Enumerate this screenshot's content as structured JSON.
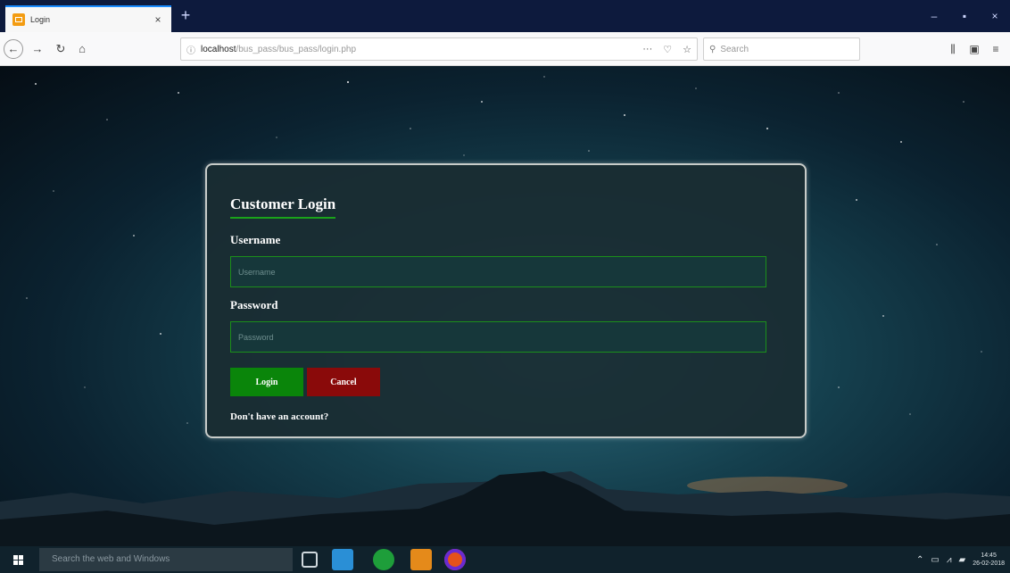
{
  "browser": {
    "tab_title": "Login",
    "tab_close": "×",
    "new_tab": "+",
    "window_controls": {
      "minimize": "–",
      "maximize": "▪",
      "close": "×"
    },
    "url_host": "localhost",
    "url_path": "/bus_pass/bus_pass/login.php",
    "search_placeholder": "Search",
    "page_actions": [
      "···",
      "♡",
      "☆"
    ]
  },
  "login": {
    "title": "Customer Login",
    "username_label": "Username",
    "username_placeholder": "Username",
    "password_label": "Password",
    "password_placeholder": "Password",
    "login_button": "Login",
    "cancel_button": "Cancel",
    "signup_text": "Don't have an account?"
  },
  "taskbar": {
    "search_placeholder": "Search the web and Windows",
    "time": "14:45",
    "date": "26-02-2018"
  },
  "colors": {
    "accent_green": "#1aa31a",
    "login_button": "#0a850a",
    "cancel_button": "#8a0a0a",
    "card_border": "#c8ccc9"
  }
}
